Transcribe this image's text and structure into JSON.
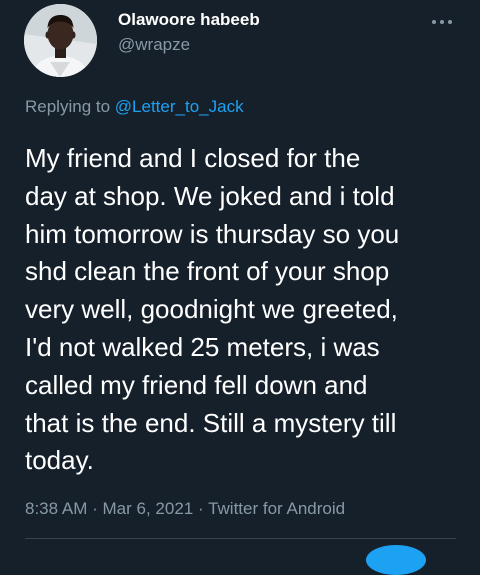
{
  "tweet": {
    "author": {
      "display_name": "Olawoore habeeb",
      "handle": "@wrapze",
      "avatar_icon": "user-photo"
    },
    "more_icon": "more-horizontal-icon",
    "replying_prefix": "Replying to",
    "replying_to": "@Letter_to_Jack",
    "text_lines": [
      "My friend and I closed for the",
      "day at shop. We joked and i told",
      "him tomorrow is thursday so you",
      "shd clean the front of your shop",
      "very well, goodnight we greeted,",
      "I'd not walked 25 meters, i was",
      "called my friend fell down and",
      "that is the end. Still a mystery till",
      "today."
    ],
    "time": "8:38 AM",
    "separator": "·",
    "date": "Mar 6, 2021",
    "source": "Twitter for Android"
  },
  "colors": {
    "background": "#15202b",
    "primary_text": "#ffffff",
    "secondary_text": "#8899a6",
    "accent": "#1da1f2",
    "divider": "#38444d"
  }
}
